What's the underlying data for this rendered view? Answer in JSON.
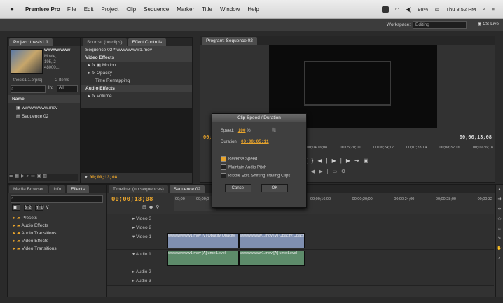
{
  "menubar": {
    "app_name": "Premiere Pro",
    "items": [
      "File",
      "Edit",
      "Project",
      "Clip",
      "Sequence",
      "Marker",
      "Title",
      "Window",
      "Help"
    ],
    "battery": "98%",
    "clock": "Thu 8:52 PM"
  },
  "app_header": {
    "workspace_label": "Workspace:",
    "workspace_value": "Editing",
    "cs_live": "CS Live"
  },
  "project_panel": {
    "tabs": [
      "Project: thesis1.1",
      "Source: (no clips)",
      "Effect Controls"
    ],
    "clip_name": "wwwwwwww",
    "clip_info": [
      "Movie,",
      "195, 2",
      "48000..."
    ],
    "project_file": "thesis1.1.prproj",
    "item_count": "2 Items",
    "in_label": "In:",
    "in_value": "All",
    "name_header": "Name",
    "items": [
      "wwwwwwww.mov",
      "Sequence 02"
    ]
  },
  "effect_controls": {
    "sequence_clip": "Sequence 02 * wwwwwww1.mov",
    "video_effects": "Video Effects",
    "motion": "Motion",
    "opacity": "Opacity",
    "time_remapping": "Time Remapping",
    "audio_effects": "Audio Effects",
    "volume": "Volume",
    "timecode": "00;00;13;08"
  },
  "program_monitor": {
    "tab": "Program: Sequence 02",
    "timecode_left": "00;00",
    "timecode_right": "00;00;13;08",
    "ruler": [
      "00;04;16;08",
      "00;05;20;10",
      "00;06;24;12",
      "00;07;28;14",
      "00;08;32;16",
      "00;09;36;18"
    ]
  },
  "media_panel": {
    "tabs": [
      "Media Browser",
      "Info",
      "Effects"
    ],
    "folders": [
      "Presets",
      "Audio Effects",
      "Audio Transitions",
      "Video Effects",
      "Video Transitions"
    ]
  },
  "timeline": {
    "tabs": [
      "Timeline: (no sequences)",
      "Sequence 02"
    ],
    "timecode": "00;00;13;08",
    "ruler_left": [
      "00;00",
      "00;00;0"
    ],
    "ruler_right": [
      "00;00;16;00",
      "00;00;20;00",
      "00;00;24;00",
      "00;00;28;00",
      "00;00;32"
    ],
    "tracks": [
      "Video 3",
      "Video 2",
      "Video 1",
      "Audio 1",
      "Audio 2",
      "Audio 3"
    ],
    "video_clip_1": "wwwwwwww1.mov [V] Opacity:Opacity",
    "video_clip_2": "wwwwwwww1.mov [V] Opacity:Opacity",
    "audio_clip_1": "wwwwwwww1.mov [A] ume:Level",
    "audio_clip_2": "wwwwwwww1.mov [A] ume:Level"
  },
  "dialog": {
    "title": "Clip Speed / Duration",
    "speed_label": "Speed:",
    "speed_value": "100",
    "speed_unit": "%",
    "duration_label": "Duration:",
    "duration_value": "00;00;05;11",
    "reverse_speed": "Reverse Speed",
    "maintain_pitch": "Maintain Audio Pitch",
    "ripple_edit": "Ripple Edit, Shifting Trailing Clips",
    "cancel": "Cancel",
    "ok": "OK",
    "reverse_checked": true
  },
  "colors": {
    "timecode": "#e8a42c",
    "video_clip": "#7f8fb0",
    "audio_clip": "#5d8b6a",
    "playhead": "#d03030"
  }
}
